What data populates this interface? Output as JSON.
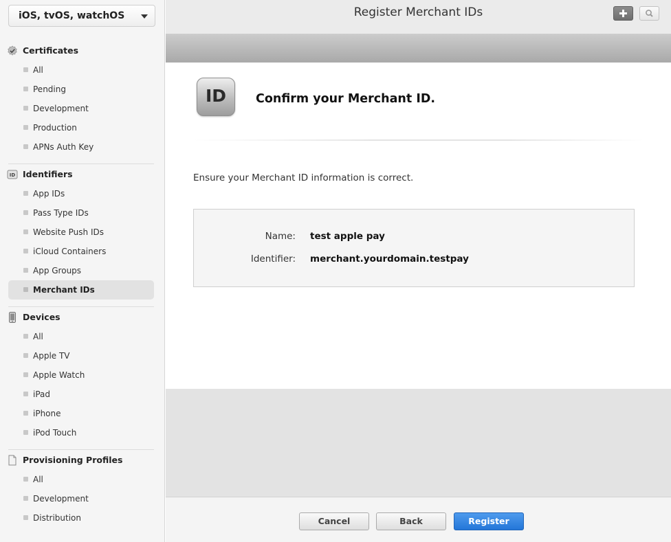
{
  "platform": {
    "label": "iOS, tvOS, watchOS"
  },
  "sidebar": {
    "sections": [
      {
        "title": "Certificates",
        "icon": "certificate-icon",
        "items": [
          "All",
          "Pending",
          "Development",
          "Production",
          "APNs Auth Key"
        ]
      },
      {
        "title": "Identifiers",
        "icon": "id-icon",
        "items": [
          "App IDs",
          "Pass Type IDs",
          "Website Push IDs",
          "iCloud Containers",
          "App Groups",
          "Merchant IDs"
        ]
      },
      {
        "title": "Devices",
        "icon": "device-icon",
        "items": [
          "All",
          "Apple TV",
          "Apple Watch",
          "iPad",
          "iPhone",
          "iPod Touch"
        ]
      },
      {
        "title": "Provisioning Profiles",
        "icon": "document-icon",
        "items": [
          "All",
          "Development",
          "Distribution"
        ]
      }
    ],
    "active_item": "Merchant IDs"
  },
  "header": {
    "title": "Register Merchant IDs",
    "add_icon": "plus-icon",
    "search_icon": "search-icon"
  },
  "main": {
    "badge_text": "ID",
    "heading": "Confirm your Merchant ID.",
    "instruction": "Ensure your Merchant ID information is correct.",
    "fields": [
      {
        "label": "Name:",
        "value": "test apple pay"
      },
      {
        "label": "Identifier:",
        "value": "merchant.yourdomain.testpay"
      }
    ]
  },
  "footer": {
    "cancel_label": "Cancel",
    "back_label": "Back",
    "register_label": "Register"
  },
  "colors": {
    "primary_button": "#2b7fde",
    "sidebar_bg": "#f5f5f5",
    "active_item_bg": "#e2e2e2"
  }
}
